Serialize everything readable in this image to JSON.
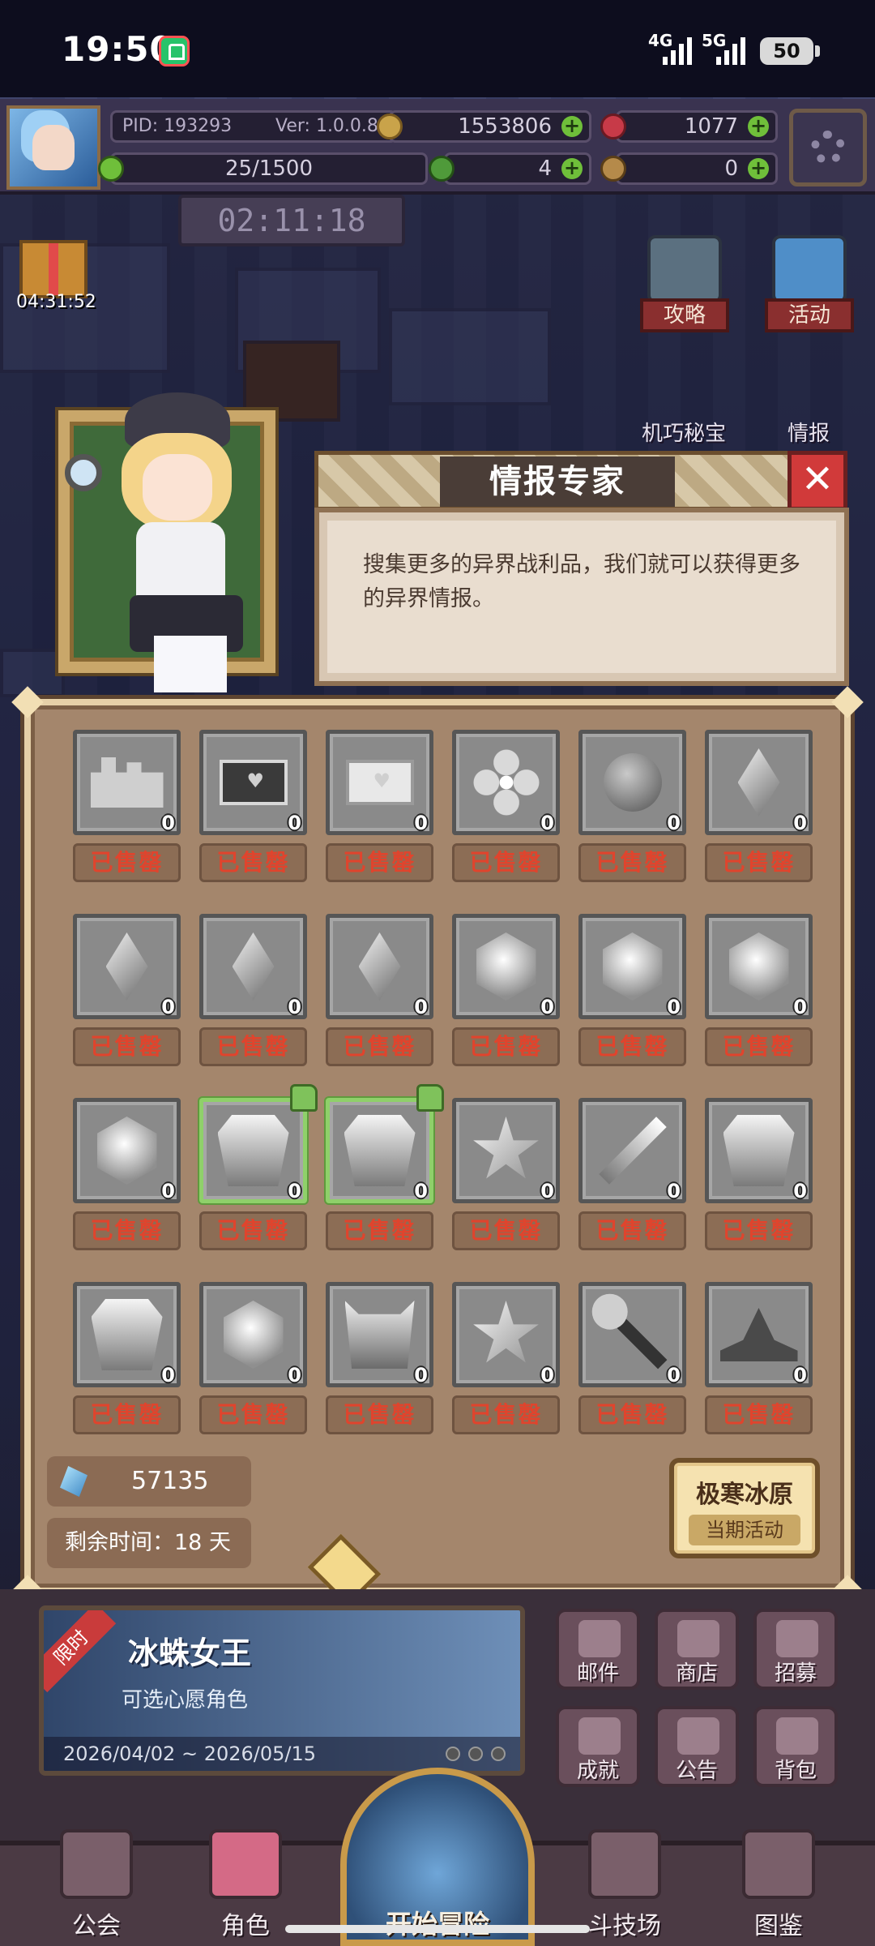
{
  "status_bar": {
    "time": "19:50",
    "network1": "4G",
    "network2": "5G",
    "battery": "50"
  },
  "hud": {
    "pid": "PID: 193293",
    "version": "Ver: 1.0.0.8",
    "gold": "1553806",
    "gems": "1077",
    "exp": "25/1500",
    "clovers": "4",
    "keys": "0"
  },
  "scene": {
    "countdown": "02:11:18",
    "gift_timer": "04:31:52",
    "buttons": [
      {
        "label": "攻略"
      },
      {
        "label": "活动"
      }
    ],
    "labels": {
      "treasure": "机巧秘宝",
      "intel": "情报"
    }
  },
  "dialog": {
    "title": "情报专家",
    "close_symbol": "✕",
    "text": "搜集更多的异界战利品，我们就可以获得更多的异界情报。"
  },
  "items": {
    "sold_label": "已售罄",
    "rows": [
      [
        {
          "icon": "castle-icon",
          "count": "0"
        },
        {
          "icon": "dark-letter-icon",
          "count": "0"
        },
        {
          "icon": "light-letter-icon",
          "count": "0"
        },
        {
          "icon": "flower-icon",
          "count": "0"
        },
        {
          "icon": "pouch-icon",
          "count": "0"
        },
        {
          "icon": "crystal-icon",
          "count": "0"
        }
      ],
      [
        {
          "icon": "crystal-icon",
          "count": "0"
        },
        {
          "icon": "crystal-icon",
          "count": "0"
        },
        {
          "icon": "crystal-icon",
          "count": "0"
        },
        {
          "icon": "gem-icon",
          "count": "0"
        },
        {
          "icon": "gem-icon",
          "count": "0"
        },
        {
          "icon": "gem-icon",
          "count": "0"
        }
      ],
      [
        {
          "icon": "gem-icon",
          "count": "0"
        },
        {
          "icon": "armor-icon",
          "count": "0",
          "recommended": true
        },
        {
          "icon": "gauntlet-icon",
          "count": "0",
          "recommended": true
        },
        {
          "icon": "star-emblem-icon",
          "count": "0"
        },
        {
          "icon": "sword-icon",
          "count": "0"
        },
        {
          "icon": "robe-icon",
          "count": "0"
        }
      ],
      [
        {
          "icon": "boots-icon",
          "count": "0"
        },
        {
          "icon": "shield-icon",
          "count": "0"
        },
        {
          "icon": "helmet-icon",
          "count": "0"
        },
        {
          "icon": "chestplate-icon",
          "count": "0"
        },
        {
          "icon": "staff-icon",
          "count": "0"
        },
        {
          "icon": "witch-hat-icon",
          "count": "0"
        }
      ]
    ]
  },
  "panel_footer": {
    "currency": "57135",
    "remaining": "剩余时间：18 天",
    "event_name": "极寒冰原",
    "event_tag": "当期活动"
  },
  "banner": {
    "ribbon": "限时",
    "title": "冰蛛女王",
    "subtitle": "可选心愿角色",
    "dates": "2026/04/02 ~ 2026/05/15"
  },
  "mini_buttons": [
    {
      "label": "邮件"
    },
    {
      "label": "商店"
    },
    {
      "label": "招募"
    },
    {
      "label": "成就"
    },
    {
      "label": "公告"
    },
    {
      "label": "背包"
    }
  ],
  "nav": {
    "guild": "公会",
    "character": "角色",
    "adventure": "开始冒险",
    "arena": "斗技场",
    "codex": "图鉴"
  }
}
